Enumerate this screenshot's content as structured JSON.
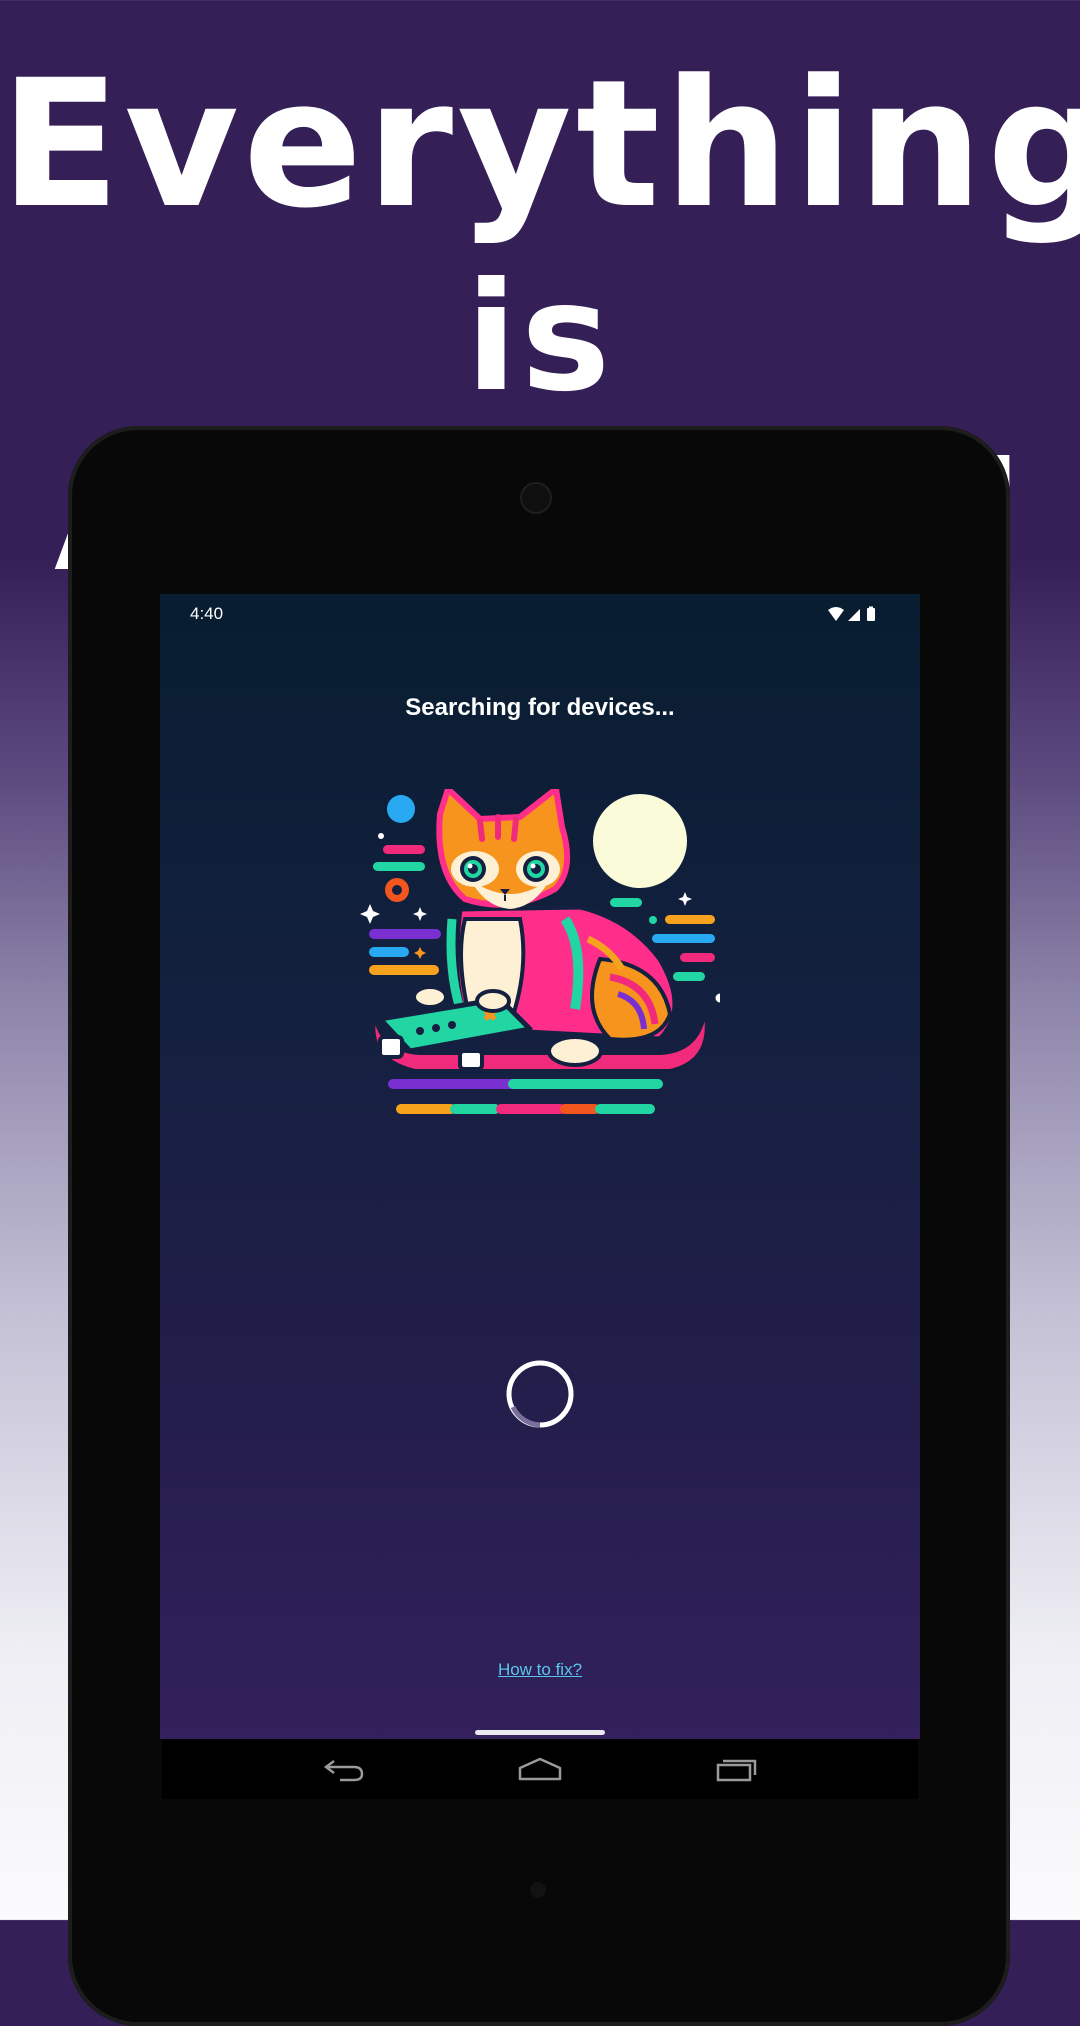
{
  "promo": {
    "headline_line1": "Everything",
    "headline_line2": "is Automated"
  },
  "status_bar": {
    "time": "4:40",
    "icons": [
      "wifi-icon",
      "cell-signal-icon",
      "battery-icon"
    ]
  },
  "screen": {
    "title": "Searching for devices...",
    "illustration": "cat-gamer-illustration",
    "loading": "loading-spinner",
    "help_link": "How to fix?"
  },
  "nav_bar": {
    "buttons": [
      "back-icon",
      "home-icon",
      "recents-icon"
    ]
  },
  "colors": {
    "promo_background": "#351f57",
    "headline_text": "#ffffff",
    "screen_top": "#081d30",
    "screen_bottom": "#33205c",
    "link": "#58c6ec",
    "tablet_bezel": "#080808"
  }
}
